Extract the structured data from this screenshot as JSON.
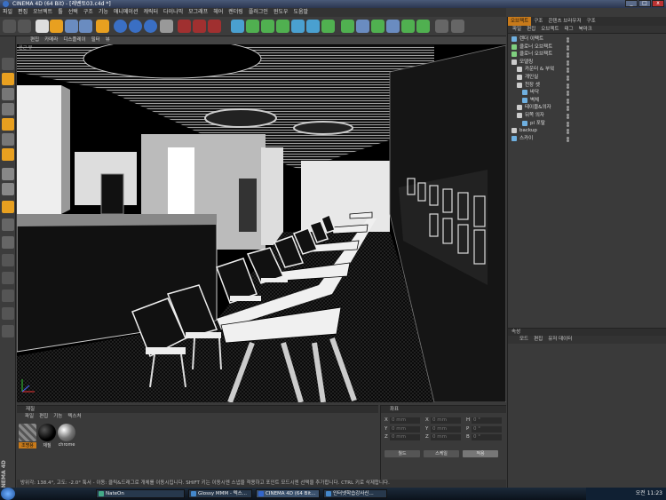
{
  "window": {
    "title": "CINEMA 4D (64 Bit) - [레벤토03.c4d *]",
    "controls": [
      "_",
      "□",
      "x"
    ]
  },
  "menu": [
    "파일",
    "편집",
    "오브젝트",
    "툴",
    "선택",
    "구조",
    "기능",
    "애니메이션",
    "캐릭터",
    "다이나믹",
    "모그래프",
    "헤어",
    "렌더링",
    "플러그인",
    "윈도우",
    "도움말"
  ],
  "viewport": {
    "menu": [
      "편집",
      "카메라",
      "디스플레이",
      "필터",
      "뷰"
    ],
    "label": "원근 뷰"
  },
  "object_manager": {
    "tabs": [
      "오브젝트",
      "구조",
      "콘텐츠 브라우저",
      "구조"
    ],
    "menu": [
      "파일",
      "편집",
      "오브젝트",
      "태그",
      "북마크"
    ],
    "objects": [
      {
        "name": "렌더 이펙트",
        "indent": 0,
        "icon": "sphere-icon",
        "color": "#6fb0e0"
      },
      {
        "name": "클로너 오브젝트",
        "indent": 0,
        "icon": "cloner-icon",
        "color": "#7fd07f"
      },
      {
        "name": "클로너 오브젝트",
        "indent": 0,
        "icon": "cloner-icon",
        "color": "#7fd07f"
      },
      {
        "name": "모델링",
        "indent": 0,
        "icon": "null-icon",
        "color": "#cccccc"
      },
      {
        "name": "카운터 & 부엌",
        "indent": 1,
        "icon": "null-icon",
        "color": "#cccccc"
      },
      {
        "name": "개인실",
        "indent": 1,
        "icon": "null-icon",
        "color": "#cccccc"
      },
      {
        "name": "천장 셋",
        "indent": 1,
        "icon": "null-icon",
        "color": "#cccccc"
      },
      {
        "name": "바닥",
        "indent": 2,
        "icon": "polygon-icon",
        "color": "#6fb0e0"
      },
      {
        "name": "벽체",
        "indent": 2,
        "icon": "polygon-icon",
        "color": "#6fb0e0"
      },
      {
        "name": "테이블&의자",
        "indent": 1,
        "icon": "null-icon",
        "color": "#cccccc"
      },
      {
        "name": "뒤쪽 의자",
        "indent": 1,
        "icon": "null-icon",
        "color": "#cccccc"
      },
      {
        "name": "pl 포탈",
        "indent": 2,
        "icon": "polygon-icon",
        "color": "#6fb0e0"
      },
      {
        "name": "backup",
        "indent": 0,
        "icon": "null-icon",
        "color": "#cccccc"
      },
      {
        "name": "스카이",
        "indent": 0,
        "icon": "sky-icon",
        "color": "#6fb0e0"
      }
    ]
  },
  "attributes": {
    "title": "속성",
    "menu": [
      "모드",
      "편집",
      "유저 데이터"
    ]
  },
  "materials": {
    "title": "재질",
    "menu": [
      "파일",
      "편집",
      "기능",
      "텍스처"
    ],
    "items": [
      {
        "name": "조명용",
        "color": "#6a6a6a"
      },
      {
        "name": "재질",
        "color": "#111111"
      },
      {
        "name": "chrome",
        "color": "#9a9a9a"
      }
    ]
  },
  "coordinates": {
    "title": "좌표",
    "rows": [
      {
        "axis1": "X",
        "val1": "0 mm",
        "axis2": "X",
        "val2": "0 mm",
        "axis3": "H",
        "val3": "0 °"
      },
      {
        "axis1": "Y",
        "val1": "0 mm",
        "axis2": "Y",
        "val2": "0 mm",
        "axis3": "P",
        "val3": "0 °"
      },
      {
        "axis1": "Z",
        "val1": "0 mm",
        "axis2": "Z",
        "val2": "0 mm",
        "axis3": "B",
        "val3": "0 °"
      }
    ],
    "buttons": [
      "월드",
      "스케일",
      "적용"
    ]
  },
  "status": "방위각: 138.4°, 고도: -2.0° 툭서 - 이동: 클릭&드래그로 개체를 이동시킵니다. SHIFT 키는 이동시엔 스냅을 적용하고 포인트 모드시엔 선택을 추가합니다. CTRL 키로 삭제합니다.",
  "taskbar": {
    "tasks": [
      {
        "label": "NateOn",
        "active": false
      },
      {
        "label": "Glossy MMM - 텍스...",
        "active": false
      },
      {
        "label": "CINEMA 4D (64 Bit...",
        "active": true
      },
      {
        "label": "인터넷학습강사신...",
        "active": false
      }
    ],
    "clock": "오전 11:23"
  }
}
